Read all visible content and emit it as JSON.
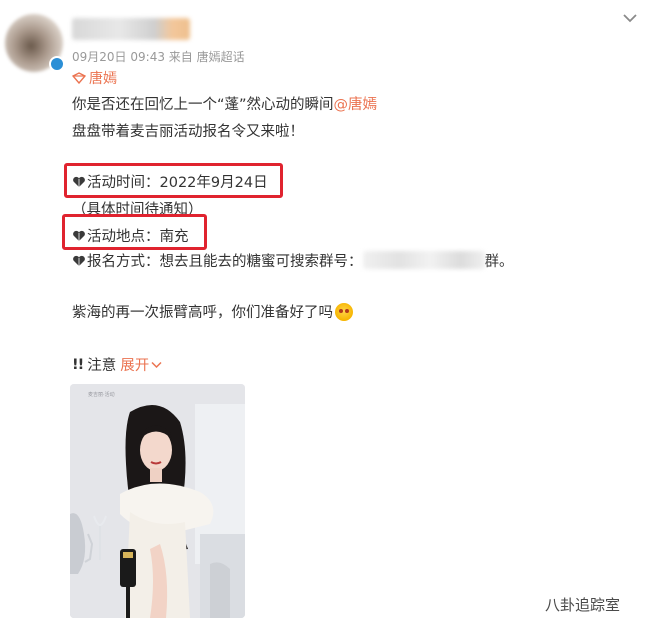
{
  "post": {
    "meta": {
      "date": "09月20日",
      "time": "09:43",
      "source_prefix": "来自",
      "source": "唐嫣超话"
    },
    "topic": "唐嫣",
    "body": {
      "line1_text": "你是否还在回忆上一个“蓬”然心动的瞬间",
      "line1_mention": "@唐嫣",
      "line2": "盘盘带着麦吉丽活动报名令又来啦！",
      "time_label": "活动时间：",
      "time_value": "2022年9月24日",
      "time_note": "（具体时间待通知）",
      "place_label": "活动地点：",
      "place_value": "南充",
      "signup_label": "报名方式：想去且能去的糖蜜可搜索群号：",
      "signup_suffix": "群。",
      "line_cheer": "紫海的再一次振臂高呼，你们准备好了吗"
    },
    "note": {
      "bang": "!!",
      "label": "注意",
      "expand": "展开"
    },
    "photo": {
      "backdrop_text": "麦吉丽·活动"
    }
  },
  "watermark": "八卦追踪室",
  "icons": {
    "heart": "heart-icon",
    "chevron": "chevron-down-icon",
    "topic": "supertopic-icon",
    "emoji": "emoji-icon"
  },
  "colors": {
    "accent": "#eb7350",
    "highlight_box": "#e0232f",
    "meta": "#999999",
    "text": "#333333"
  }
}
